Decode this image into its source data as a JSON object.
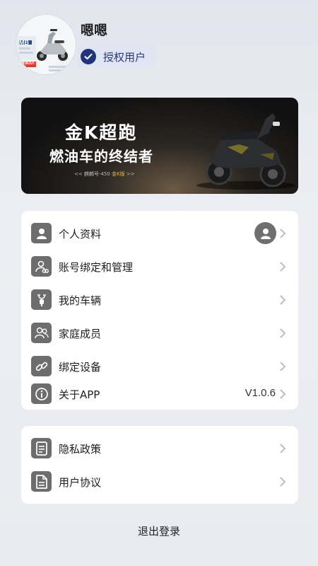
{
  "profile": {
    "username": "嗯嗯",
    "auth_badge": "授权用户",
    "avatar_icon": "scooter-avatar-image",
    "avatar_tags": {
      "model": "MB",
      "price": "¥900!"
    }
  },
  "banner": {
    "title": "金K超跑",
    "subtitle": "燃油车的终结者",
    "tagline_prefix": "<< 麒麟号-450",
    "tagline_highlight": "金K版",
    "tagline_suffix": ">>"
  },
  "menu_main": [
    {
      "label": "个人资料",
      "icon": "person-icon",
      "value": ""
    },
    {
      "label": "账号绑定和管理",
      "icon": "account-link-icon",
      "value": ""
    },
    {
      "label": "我的车辆",
      "icon": "scooter-icon",
      "value": ""
    },
    {
      "label": "家庭成员",
      "icon": "family-icon",
      "value": ""
    },
    {
      "label": "绑定设备",
      "icon": "chain-link-icon",
      "value": ""
    },
    {
      "label": "关于APP",
      "icon": "info-icon",
      "value": "V1.0.6"
    }
  ],
  "menu_legal": [
    {
      "label": "隐私政策",
      "icon": "document-icon"
    },
    {
      "label": "用户协议",
      "icon": "agreement-icon"
    }
  ],
  "logout_label": "退出登录",
  "colors": {
    "badge_bg": "#dfe5f3",
    "badge_check": "#23357a",
    "icon_bg": "#6d6d6d",
    "chevron": "#bdbdbd"
  }
}
